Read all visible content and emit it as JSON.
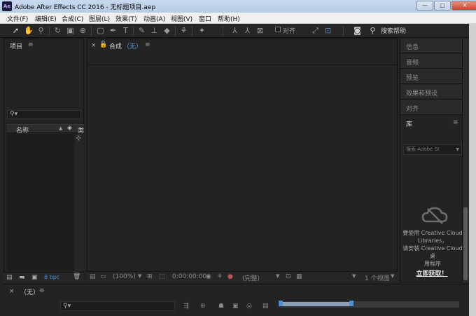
{
  "window": {
    "title": "Adobe After Effects CC 2016 - 无标题项目.aep",
    "app_icon_text": "Ae",
    "controls": [
      "—",
      "□",
      "✕"
    ]
  },
  "menu": [
    "文件(F)",
    "编辑(E)",
    "合成(C)",
    "图层(L)",
    "效果(T)",
    "动画(A)",
    "视图(V)",
    "窗口",
    "帮助(H)"
  ],
  "toolbar": {
    "icons": [
      "selection-tool",
      "hand-tool",
      "zoom-tool",
      "rotate-tool",
      "camera-tool",
      "pan-behind-tool",
      "rectangle-tool",
      "pen-tool",
      "type-tool",
      "brush-tool",
      "clone-stamp-tool",
      "eraser-tool",
      "roto-brush-tool",
      "puppet-pin-tool"
    ],
    "snap_label": "对齐",
    "search_label": "搜索帮助"
  },
  "project_panel": {
    "tab_label": "项目",
    "column_name": "名称",
    "column_type": "类",
    "bpc": "8 bpc"
  },
  "comp_panel": {
    "tab_label": "合成",
    "tab_value": "（无）",
    "zoom": "(100%)",
    "timecode": "0:00:00:00",
    "resolution": "(完整)",
    "view_count": "1 个视图"
  },
  "right_panels": {
    "items": [
      "信息",
      "音频",
      "预览",
      "效果和预设",
      "对齐"
    ],
    "library_tab": "库",
    "library_select": "搜索 Adobe St",
    "library_msg": [
      "要使用 Creative Cloud",
      "Libraries，",
      "请安装 Creative Cloud 桌",
      "用程序"
    ],
    "library_link": "立即获取！"
  },
  "timeline": {
    "tab_label": "（无）"
  },
  "colors": {
    "panel_bg": "#232323",
    "accent_blue": "#4d8fd9",
    "title_bar": "#c9d9ee"
  }
}
